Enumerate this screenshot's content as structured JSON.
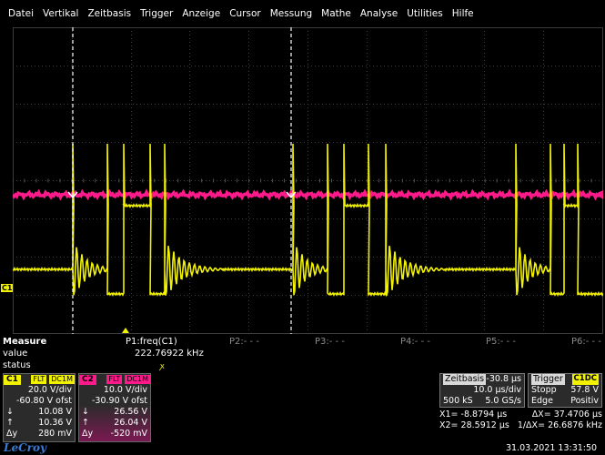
{
  "menu": [
    "Datei",
    "Vertikal",
    "Zeitbasis",
    "Trigger",
    "Anzeige",
    "Cursor",
    "Messung",
    "Mathe",
    "Analyse",
    "Utilities",
    "Hilfe"
  ],
  "colors": {
    "c1": "#f2f200",
    "c2": "#ff1a8c",
    "grid": "#3c3c3c",
    "cursor": "#ffffff"
  },
  "markers": {
    "c1": "C1"
  },
  "measure": {
    "title": "Measure",
    "value_label": "value",
    "status_label": "status",
    "p1_label": "P1:freq(C1)",
    "p1_value": "222.76922 kHz",
    "p1_status": "ꭗ",
    "slots": [
      "P2:- - -",
      "P3:- - -",
      "P4:- - -",
      "P5:- - -",
      "P6:- - -"
    ]
  },
  "c1": {
    "tag": "C1",
    "badges": [
      "FLT",
      "DC1M"
    ],
    "vdiv": "20.0 V/div",
    "offset": "-60.80 V ofst",
    "down": "10.08 V",
    "up": "10.36 V",
    "delta": "280 mV",
    "down_sym": "↓",
    "up_sym": "↑",
    "delta_sym": "Δy"
  },
  "c2": {
    "tag": "C2",
    "badges": [
      "FLT",
      "DC1M"
    ],
    "vdiv": "10.0 V/div",
    "offset": "-30.90 V ofst",
    "down": "26.56 V",
    "up": "26.04 V",
    "delta": "-520 mV",
    "down_sym": "↓",
    "up_sym": "↑",
    "delta_sym": "Δy"
  },
  "timebase": {
    "label": "Zeitbasis",
    "delay": "-30.8 µs",
    "tdiv": "10.0 µs/div",
    "samples": "500 kS",
    "rate": "5.0 GS/s"
  },
  "trigger": {
    "label": "Trigger",
    "source": "C1DC",
    "mode": "Stopp",
    "level": "57.8 V",
    "type": "Edge",
    "slope": "Positiv"
  },
  "cursors": {
    "x1_label": "X1=",
    "x1": "-8.8794 µs",
    "dx_label": "ΔX=",
    "dx": "37.4706 µs",
    "x2_label": "X2=",
    "x2": "28.5912 µs",
    "inv_dx_label": "1/ΔX=",
    "inv_dx": "26.6876 kHz"
  },
  "logo": "LeCroy",
  "datetime": "31.03.2021 13:31:50"
}
